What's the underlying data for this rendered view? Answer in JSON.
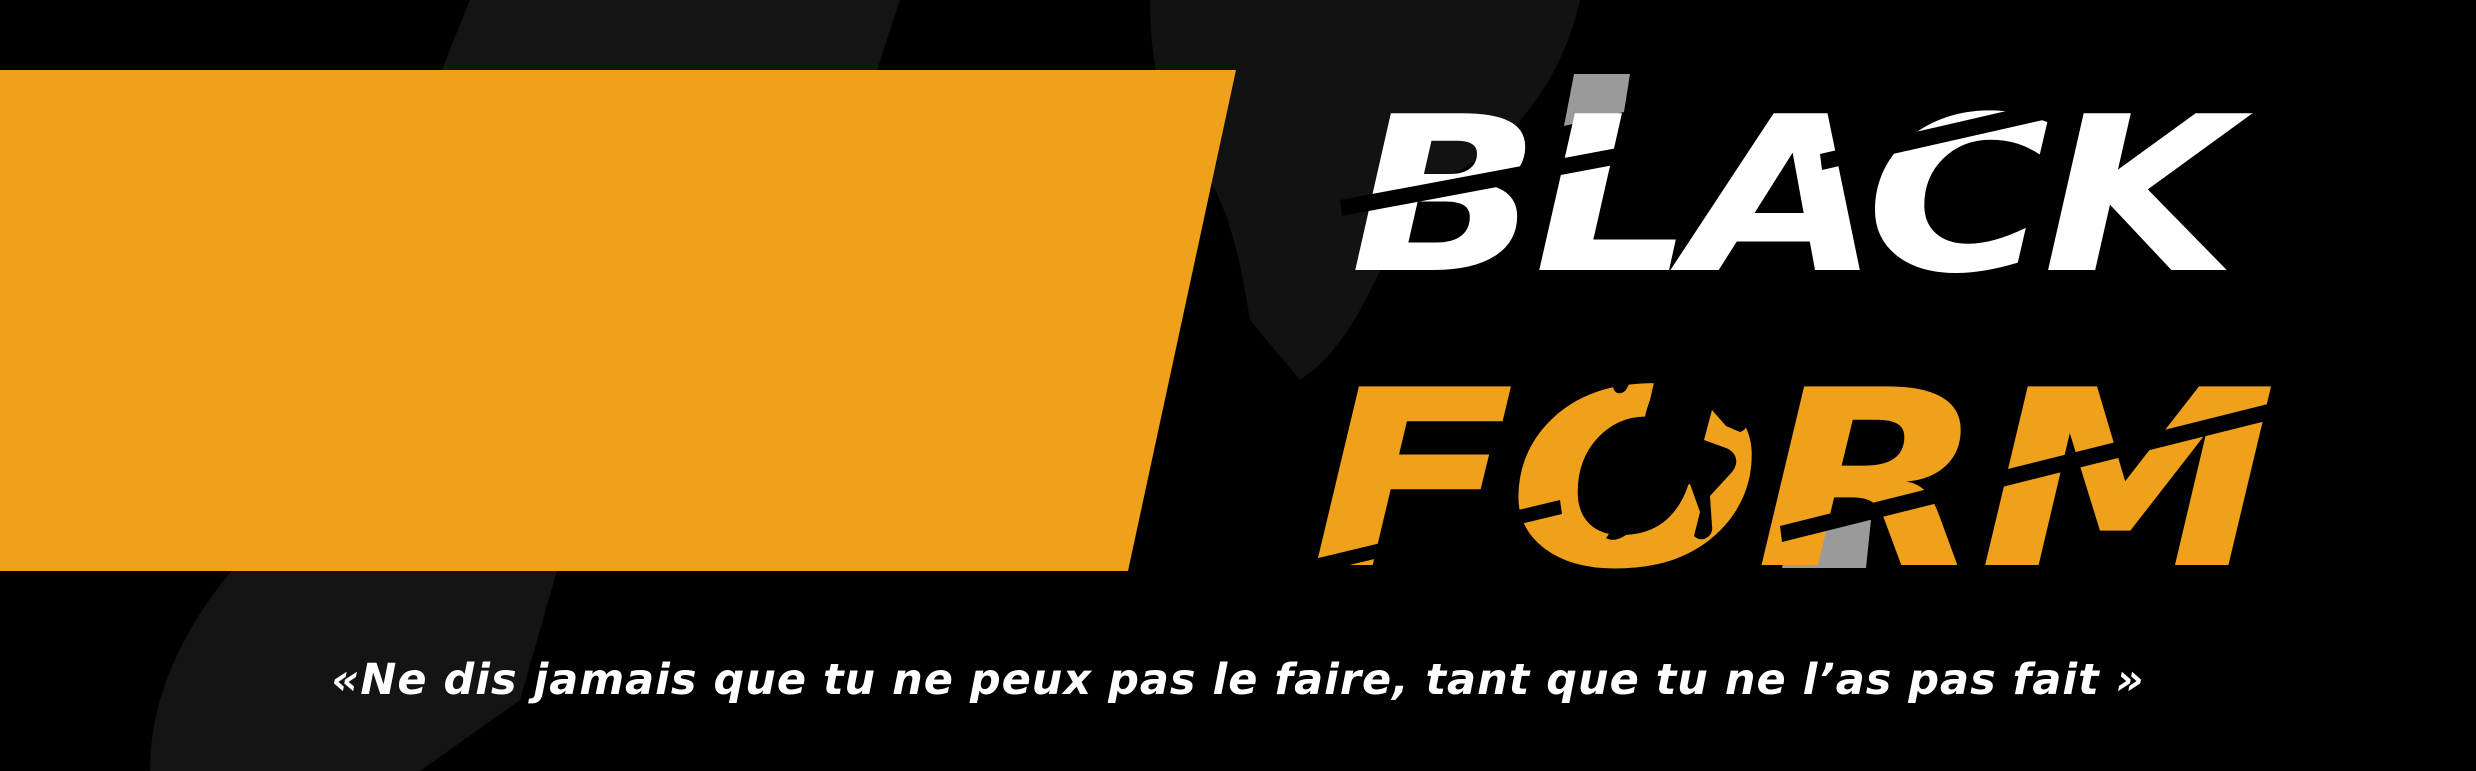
{
  "brand": {
    "line1": "BLACK",
    "line2": "FORM",
    "line1_color": "#ffffff",
    "line2_color": "#f0a11b"
  },
  "slogan": {
    "text": "«Ne dis jamais que tu ne peux pas le faire, tant que tu ne l’as pas fait »"
  },
  "colors": {
    "background": "#000000",
    "accent": "#f0a11b",
    "silhouette": "#141414",
    "stripe_gray": "#9a9a9a",
    "text": "#ffffff"
  },
  "icons": {
    "runner": "runner-silhouette-icon"
  }
}
